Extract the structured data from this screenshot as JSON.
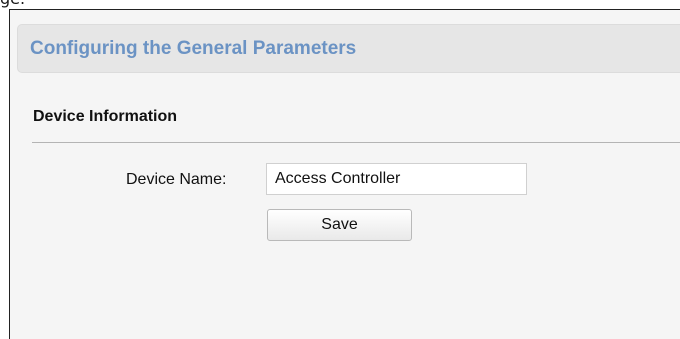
{
  "top_caption": "ge.",
  "header": {
    "title": "Configuring the General Parameters"
  },
  "section": {
    "title": "Device Information"
  },
  "form": {
    "device_name_label": "Device Name:",
    "device_name_value": "Access Controller",
    "save_label": "Save"
  }
}
